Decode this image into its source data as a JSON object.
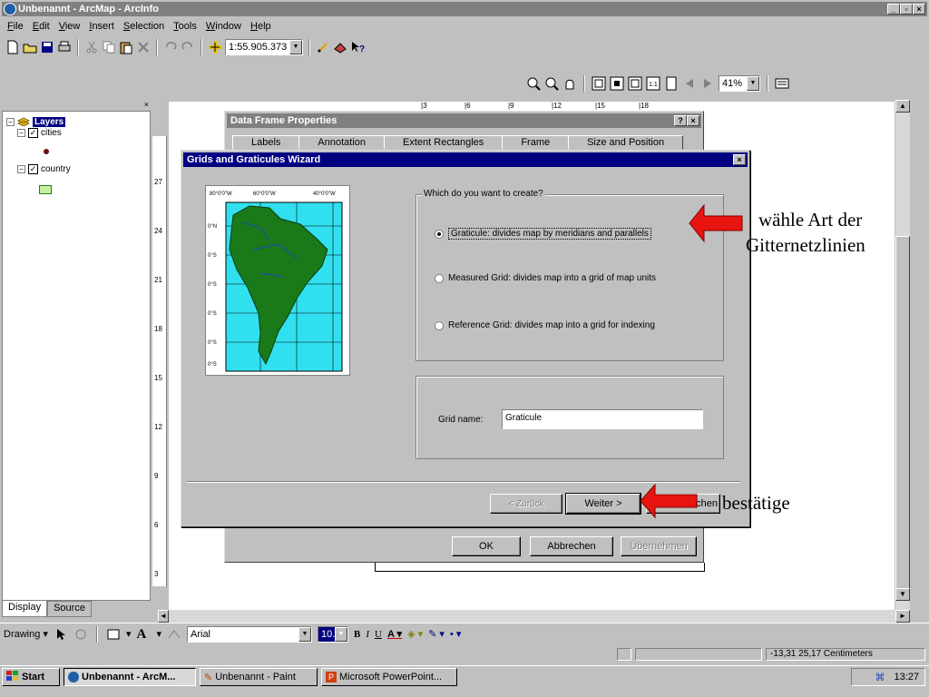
{
  "window": {
    "title": "Unbenannt - ArcMap - ArcInfo"
  },
  "menu": [
    "File",
    "Edit",
    "View",
    "Insert",
    "Selection",
    "Tools",
    "Window",
    "Help"
  ],
  "menu_underline": [
    "F",
    "E",
    "V",
    "I",
    "S",
    "T",
    "W",
    "H"
  ],
  "toolbar": {
    "scale": "1:55.905.373",
    "zoom": "41%"
  },
  "toc": {
    "root": "Layers",
    "layers": [
      {
        "name": "cities"
      },
      {
        "name": "country"
      }
    ],
    "tabs": [
      "Display",
      "Source"
    ]
  },
  "ruler": {
    "h_ticks": [
      "3",
      "6",
      "9",
      "12",
      "15",
      "18"
    ],
    "v_ticks": [
      "27",
      "24",
      "21",
      "18",
      "15",
      "12",
      "9",
      "6",
      "3"
    ]
  },
  "data_frame_dialog": {
    "title": "Data Frame Properties",
    "tabs": [
      "Labels",
      "Annotation",
      "Extent Rectangles",
      "Frame",
      "Size and Position"
    ],
    "ok": "OK",
    "cancel": "Abbrechen",
    "apply": "Übernehmen"
  },
  "wizard": {
    "title": "Grids and Graticules Wizard",
    "preview_lon": [
      "80°0'0\"W",
      "60°0'0\"W",
      "40°0'0\"W"
    ],
    "preview_lat": [
      "0°N",
      "0°S",
      "0°S",
      "0°S",
      "0°S",
      "0°S"
    ],
    "question": "Which do you want to create?",
    "options": [
      {
        "label": "Graticule: divides map by meridians and parallels",
        "selected": true
      },
      {
        "label": "Measured Grid: divides map into a grid of map units",
        "selected": false
      },
      {
        "label": "Reference Grid: divides map into a grid for indexing",
        "selected": false
      }
    ],
    "grid_name_label": "Grid name:",
    "grid_name_value": "Graticule",
    "back": "< Zurück",
    "next": "Weiter >",
    "cancel_partial": "echen"
  },
  "drawing_toolbar": {
    "drawing": "Drawing",
    "font": "Arial",
    "size": "10.0"
  },
  "status": {
    "coords": "-13,31  25,17 Centimeters"
  },
  "taskbar": {
    "start": "Start",
    "items": [
      "Unbenannt - ArcM...",
      "Unbenannt - Paint",
      "Microsoft PowerPoint..."
    ],
    "time": "13:27"
  },
  "annotations": {
    "line1": "wähle Art der",
    "line2": "Gitternetzlinien",
    "confirm": "bestätige"
  },
  "colors": {
    "arrow": "#e8140f",
    "land": "#1a7a1a",
    "ocean": "#31e0ef",
    "title_active": "#000080",
    "title_inactive": "#808080"
  }
}
